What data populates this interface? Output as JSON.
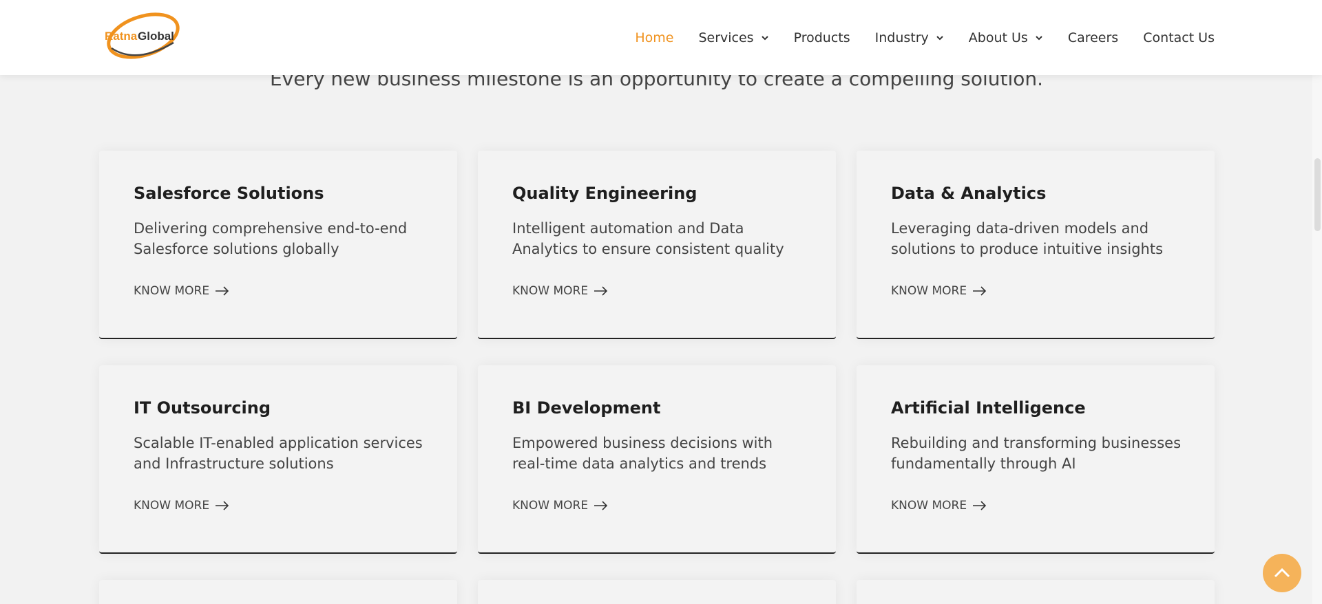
{
  "header": {
    "logo_text_part1": "Ratna",
    "logo_text_part2": "Global",
    "nav": [
      {
        "label": "Home",
        "active": true,
        "has_dropdown": false
      },
      {
        "label": "Services",
        "active": false,
        "has_dropdown": true
      },
      {
        "label": "Products",
        "active": false,
        "has_dropdown": false
      },
      {
        "label": "Industry",
        "active": false,
        "has_dropdown": true
      },
      {
        "label": "About Us",
        "active": false,
        "has_dropdown": true
      },
      {
        "label": "Careers",
        "active": false,
        "has_dropdown": false
      },
      {
        "label": "Contact Us",
        "active": false,
        "has_dropdown": false
      }
    ]
  },
  "tagline": "Every new business milestone is an opportunity to create a compelling solution.",
  "cards": [
    {
      "title": "Salesforce Solutions",
      "desc_line1": "Delivering comprehensive end-to-end",
      "desc_line2": "Salesforce solutions globally",
      "link": "KNOW MORE"
    },
    {
      "title": "Quality Engineering",
      "desc_line1": "Intelligent automation and Data",
      "desc_line2": "Analytics to ensure consistent quality",
      "link": "KNOW MORE"
    },
    {
      "title": "Data & Analytics",
      "desc_line1": "Leveraging data-driven models and",
      "desc_line2": "solutions to produce intuitive insights",
      "link": "KNOW MORE"
    },
    {
      "title": "IT Outsourcing",
      "desc_line1": "Scalable IT-enabled application services",
      "desc_line2": "and Infrastructure solutions",
      "link": "KNOW MORE"
    },
    {
      "title": "BI Development",
      "desc_line1": "Empowered business decisions with",
      "desc_line2": "real-time data analytics and trends",
      "link": "KNOW MORE"
    },
    {
      "title": "Artificial Intelligence",
      "desc_line1": "Rebuilding and transforming businesses",
      "desc_line2": "fundamentally through AI",
      "link": "KNOW MORE"
    }
  ],
  "colors": {
    "accent": "#f0921e",
    "back_to_top": "#f5b35a",
    "background": "#f2f2f2"
  },
  "icons": {
    "card_link": "arrow-right-icon",
    "nav_dropdown": "chevron-down-icon",
    "back_to_top": "chevron-up-icon"
  }
}
